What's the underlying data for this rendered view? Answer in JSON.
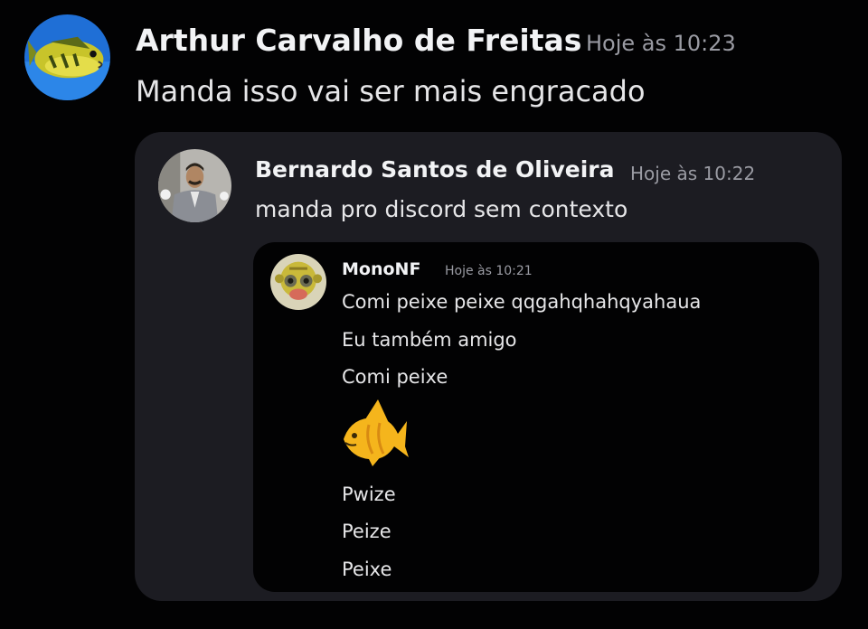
{
  "reply": {
    "author": "Arthur Carvalho de Freitas",
    "timestamp": "Hoje às 10:23",
    "message": "Manda isso vai ser mais engracado",
    "avatar_icon": "fish-avatar-icon"
  },
  "quote": {
    "author": "Bernardo Santos de Oliveira",
    "timestamp": "Hoje às 10:22",
    "message": "manda pro discord sem contexto",
    "avatar_icon": "man-in-suit-avatar-icon"
  },
  "nested_quote": {
    "author": "MonoNF",
    "timestamp": "Hoje às 10:21",
    "lines": [
      "Comi peixe peixe qqgahqhahqyahaua",
      "Eu também amigo",
      "Comi peixe",
      "Pwize",
      "Peize",
      "Peixe"
    ],
    "emoji": "tropical-fish-emoji-icon",
    "avatar_icon": "monkey-avatar-icon"
  },
  "colors": {
    "background": "#020203",
    "quote_panel": "#1c1c22",
    "timestamp": "#9a9ba3",
    "fish_emoji": "#f5b51c"
  }
}
